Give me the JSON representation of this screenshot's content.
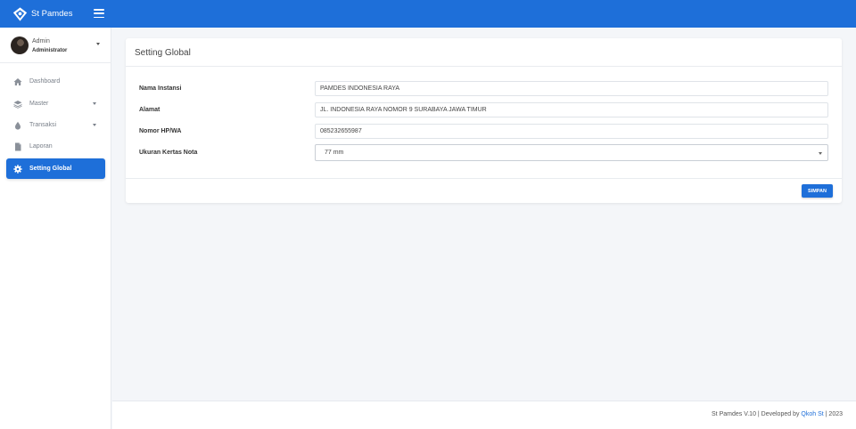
{
  "app": {
    "name": "St Pamdes"
  },
  "colors": {
    "primary": "#1e6fd9",
    "background": "#f4f6f9"
  },
  "user": {
    "name": "Admin",
    "role": "Administrator"
  },
  "sidebar": {
    "items": [
      {
        "label": "Dashboard",
        "icon": "home-icon"
      },
      {
        "label": "Master",
        "icon": "layers-icon",
        "has_submenu": true
      },
      {
        "label": "Transaksi",
        "icon": "droplet-icon",
        "has_submenu": true
      },
      {
        "label": "Laporan",
        "icon": "file-icon"
      },
      {
        "label": "Setting Global",
        "icon": "gear-icon",
        "active": true
      }
    ]
  },
  "page": {
    "title": "Setting Global"
  },
  "form": {
    "nama_instansi": {
      "label": "Nama Instansi",
      "value": "PAMDES INDONESIA RAYA"
    },
    "alamat": {
      "label": "Alamat",
      "value": "JL. INDONESIA RAYA NOMOR 9 SURABAYA JAWA TIMUR"
    },
    "nomor_hp": {
      "label": "Nomor HP/WA",
      "value": "085232655987"
    },
    "ukuran_kertas": {
      "label": "Ukuran Kertas Nota",
      "value": "77 mm"
    },
    "save_label": "SIMPAN"
  },
  "footer": {
    "prefix": "St Pamdes V.10 | Developed by ",
    "link": "Qkoh St",
    "suffix": " | 2023"
  }
}
